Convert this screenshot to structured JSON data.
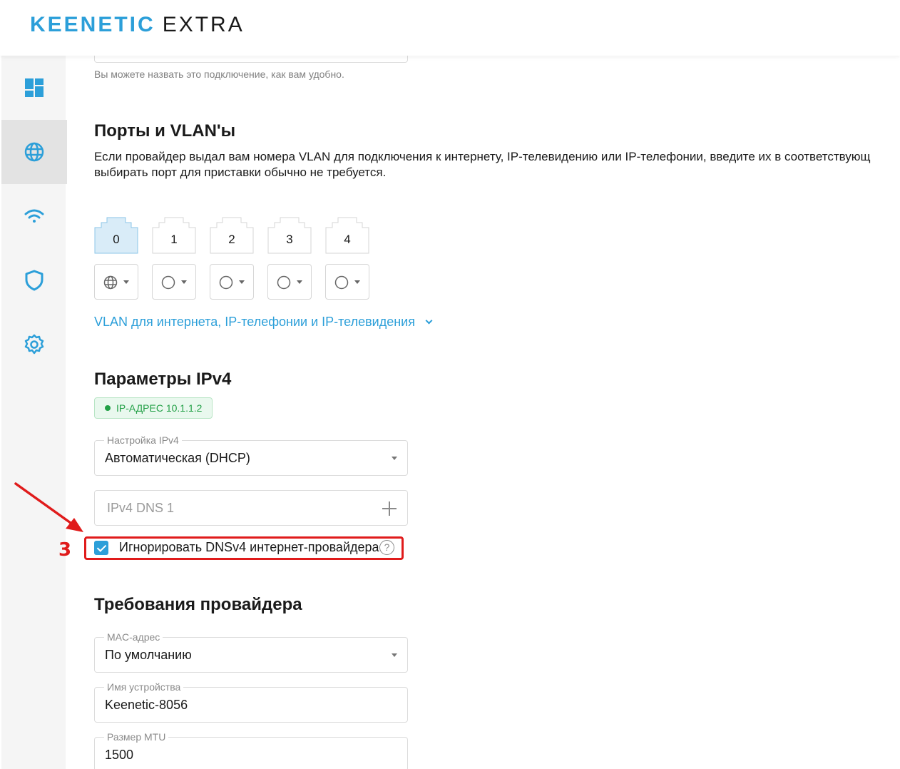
{
  "header": {
    "brand": "KEENETIC",
    "model": "EXTRA"
  },
  "sidebar": {
    "items": [
      {
        "icon": "dashboard-icon",
        "active": false
      },
      {
        "icon": "globe-icon",
        "active": true
      },
      {
        "icon": "wifi-icon",
        "active": false
      },
      {
        "icon": "shield-icon",
        "active": false
      },
      {
        "icon": "gear-icon",
        "active": false
      }
    ]
  },
  "connection_name": {
    "hint": "Вы можете назвать это подключение, как вам удобно."
  },
  "ports_section": {
    "title": "Порты и VLAN'ы",
    "description_line1": "Если провайдер выдал вам номера VLAN для подключения к интернету, IP-телевидению или IP-телефонии, введите их в соответствующ",
    "description_line2": "выбирать порт для приставки обычно не требуется.",
    "ports": [
      {
        "label": "0",
        "mode_icon": "globe-icon",
        "selected": true
      },
      {
        "label": "1",
        "mode_icon": "circle-icon",
        "selected": false
      },
      {
        "label": "2",
        "mode_icon": "circle-icon",
        "selected": false
      },
      {
        "label": "3",
        "mode_icon": "circle-icon",
        "selected": false
      },
      {
        "label": "4",
        "mode_icon": "circle-icon",
        "selected": false
      }
    ],
    "vlan_link": "VLAN для интернета, IP-телефонии и IP-телевидения"
  },
  "ipv4_section": {
    "title": "Параметры IPv4",
    "ip_badge": "IP-АДРЕС 10.1.1.2",
    "ipv4_setting": {
      "label": "Настройка IPv4",
      "value": "Автоматическая (DHCP)"
    },
    "dns1": {
      "placeholder": "IPv4 DNS 1"
    },
    "ignore_dns": {
      "label": "Игнорировать DNSv4 интернет-провайдера",
      "checked": true,
      "help": "?"
    }
  },
  "provider_section": {
    "title": "Требования провайдера",
    "mac": {
      "label": "MAC-адрес",
      "value": "По умолчанию"
    },
    "device_name": {
      "label": "Имя устройства",
      "value": "Keenetic-8056"
    },
    "mtu": {
      "label": "Размер MTU",
      "value": "1500"
    }
  },
  "annotation": {
    "step_number": "3",
    "color": "#e01b1b"
  },
  "colors": {
    "accent": "#2c9fd9",
    "success": "#23a047",
    "sidebar_bg": "#f5f5f5"
  }
}
